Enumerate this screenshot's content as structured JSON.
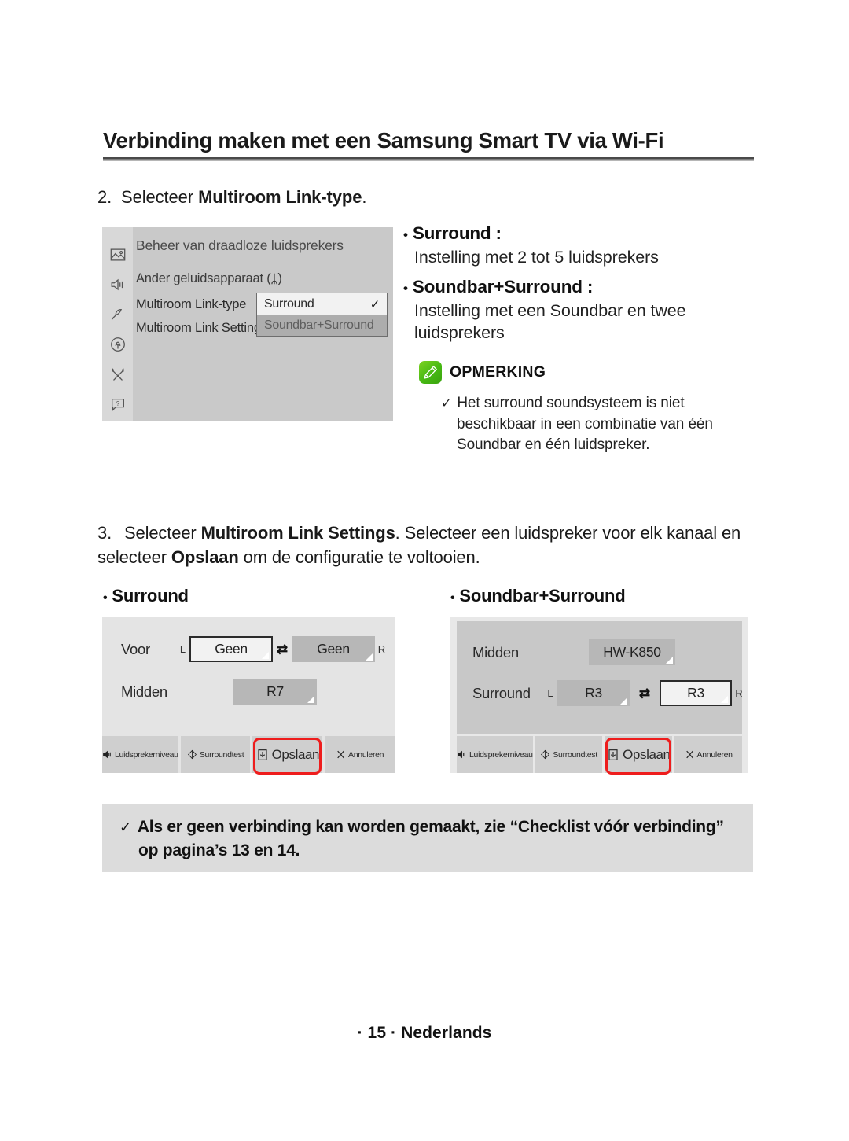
{
  "header": {
    "title": "Verbinding maken met een Samsung Smart TV via Wi-Fi"
  },
  "step2": {
    "number": "2.",
    "text_before": "Selecteer ",
    "bold": "Multiroom Link-type",
    "text_after": "."
  },
  "tv_menu": {
    "title": "Beheer van draadloze luidsprekers",
    "sidebar_icons": [
      "picture-icon",
      "sound-icon",
      "broadcast-icon",
      "network-icon",
      "tools-icon",
      "support-icon"
    ],
    "rows": [
      {
        "label": "Ander geluidsapparaat (",
        "bluetooth": "ᛦ",
        "suffix": ")"
      },
      {
        "label": "Multiroom Link-type"
      },
      {
        "label": "Multiroom Link Settings"
      }
    ],
    "dropdown": {
      "selected_option": "Surround",
      "check_glyph": "✓",
      "dim_option": "Soundbar+Surround"
    }
  },
  "description": {
    "bullet_glyph": "•",
    "items": [
      {
        "title": "Surround :",
        "body": "Instelling met 2 tot 5 luidsprekers"
      },
      {
        "title": "Soundbar+Surround :",
        "body": "Instelling met een Soundbar en twee luidsprekers"
      }
    ],
    "note": {
      "icon_name": "pencil-note-icon",
      "icon_color": "#46b813",
      "title": "OPMERKING",
      "tick_glyph": "✓",
      "text": "Het surround soundsysteem is niet beschikbaar in een combinatie van één Soundbar en één luidspreker."
    }
  },
  "step3": {
    "number": "3.",
    "seg1": "Selecteer ",
    "bold1": "Multiroom Link Settings",
    "seg2": ". Selecteer een luidspreker voor elk kanaal en selecteer ",
    "bold2": "Opslaan",
    "seg3": " om de configuratie te voltooien."
  },
  "config": {
    "left": {
      "label": "Surround",
      "rows": [
        {
          "name": "Voor",
          "left_tag": "L",
          "left_value": "Geen",
          "swap_glyph": "⇄",
          "right_value": "Geen",
          "right_tag": "R"
        },
        {
          "name": "Midden",
          "value": "R7"
        }
      ],
      "toolbar": [
        {
          "label": "Luidsprekerniveau",
          "icon": "speaker-icon"
        },
        {
          "label": "Surroundtest",
          "icon": "surround-test-icon"
        },
        {
          "label": "Opslaan",
          "icon": "save-icon",
          "highlighted": true
        },
        {
          "label": "Annuleren",
          "icon": "x-icon"
        }
      ]
    },
    "right": {
      "label": "Soundbar+Surround",
      "rows": [
        {
          "name": "Midden",
          "value": "HW-K850"
        },
        {
          "name": "Surround",
          "left_tag": "L",
          "left_value": "R3",
          "swap_glyph": "⇄",
          "right_value": "R3",
          "right_tag": "R"
        }
      ],
      "toolbar": [
        {
          "label": "Luidsprekerniveau",
          "icon": "speaker-icon"
        },
        {
          "label": "Surroundtest",
          "icon": "surround-test-icon"
        },
        {
          "label": "Opslaan",
          "icon": "save-icon",
          "highlighted": true
        },
        {
          "label": "Annuleren",
          "icon": "x-icon"
        }
      ]
    },
    "highlight_color": "#ee1d1d"
  },
  "bottom_note": {
    "tick_glyph": "✓",
    "text": "Als er geen verbinding kan worden gemaakt, zie “Checklist vóór verbinding” op pagina’s 13 en 14."
  },
  "footer": {
    "text": "· 15 · Nederlands"
  }
}
